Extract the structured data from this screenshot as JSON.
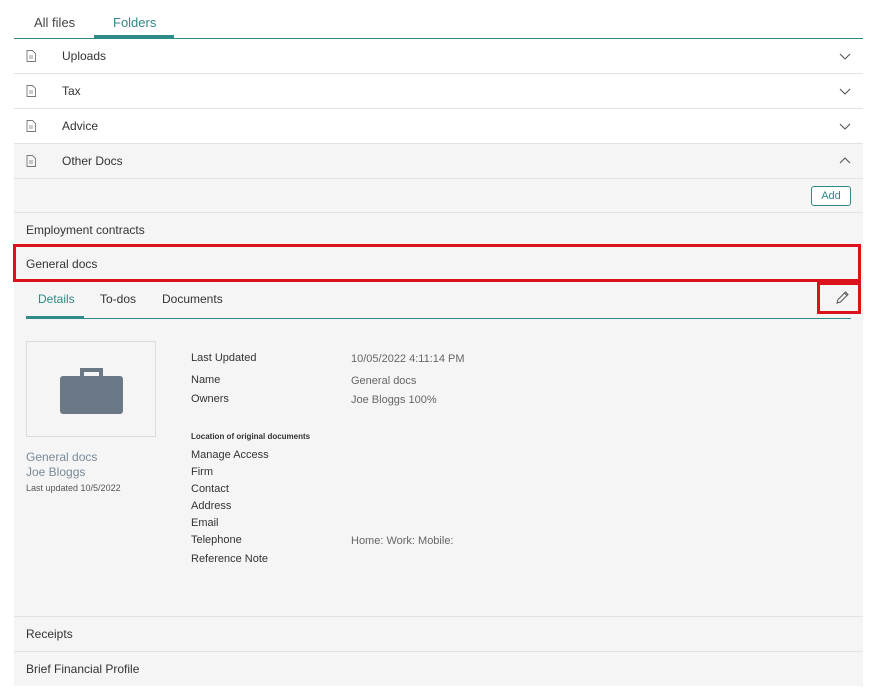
{
  "top_tabs": [
    "All files",
    "Folders"
  ],
  "folders": [
    {
      "label": "Uploads",
      "icon": "document-icon",
      "chevron": "chevron-down-icon"
    },
    {
      "label": "Tax",
      "icon": "document-icon",
      "chevron": "chevron-down-icon"
    },
    {
      "label": "Advice",
      "icon": "document-icon",
      "chevron": "chevron-down-icon"
    },
    {
      "label": "Other Docs",
      "icon": "document-icon",
      "chevron": "chevron-up-icon"
    }
  ],
  "panel": {
    "add_label": "Add",
    "items": [
      "Employment contracts",
      "General docs",
      "Receipts",
      "Brief Financial Profile"
    ],
    "detail_tabs": [
      "Details",
      "To-dos",
      "Documents"
    ],
    "card": {
      "icon": "briefcase-icon",
      "title": "General docs",
      "owner": "Joe Bloggs",
      "updated": "Last updated 10/5/2022"
    },
    "fields": {
      "last_updated_label": "Last Updated",
      "last_updated_value": "10/05/2022 4:11:14 PM",
      "name_label": "Name",
      "name_value": "General docs",
      "owners_label": "Owners",
      "owners_value": "Joe Bloggs 100%",
      "location_heading": "Location of original documents",
      "manage_access_label": "Manage Access",
      "firm_label": "Firm",
      "contact_label": "Contact",
      "address_label": "Address",
      "email_label": "Email",
      "telephone_label": "Telephone",
      "telephone_value": "Home: Work: Mobile:",
      "reference_note_label": "Reference Note"
    }
  },
  "colors": {
    "accent": "#2e8b87",
    "highlight": "#d9121b",
    "panel_bg": "#f5f5f5"
  }
}
